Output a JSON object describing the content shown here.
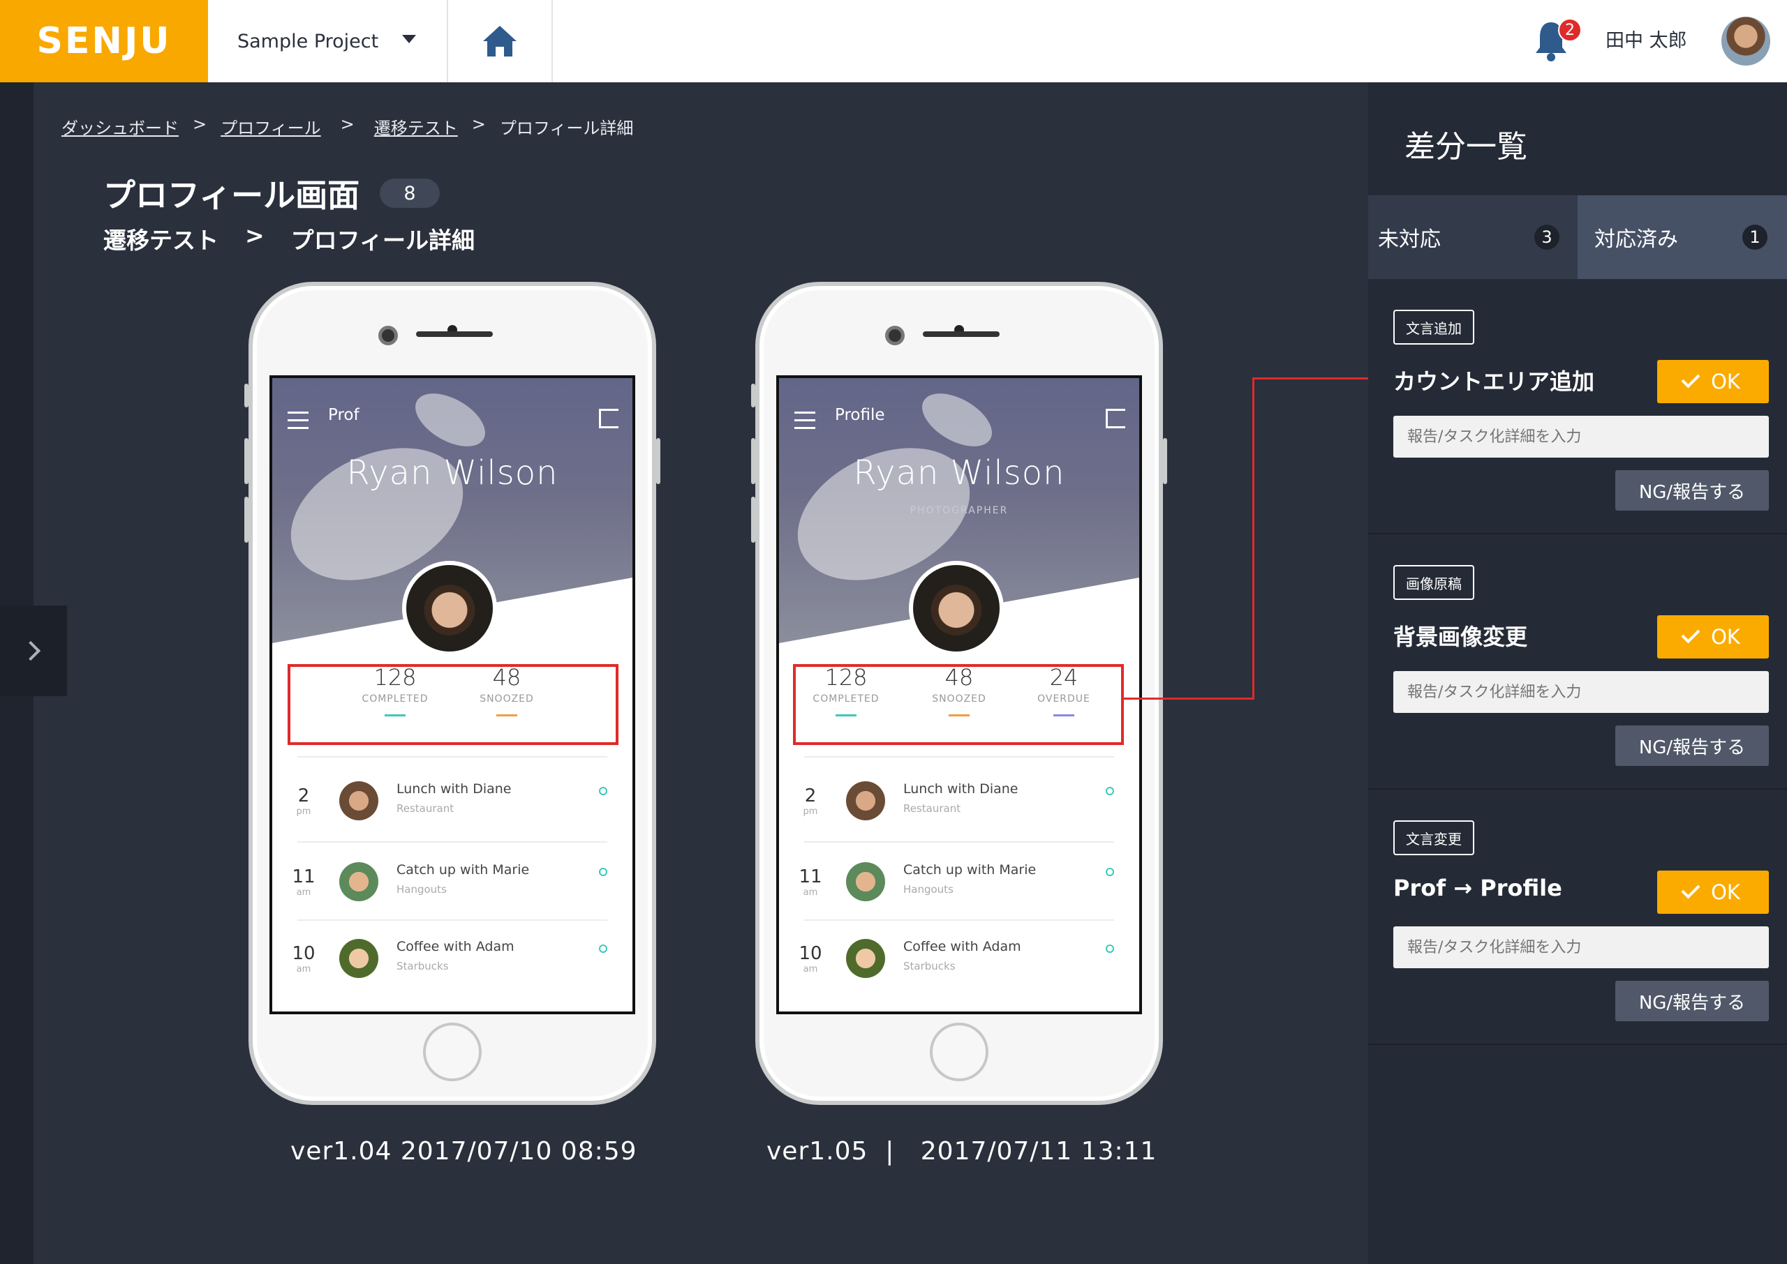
{
  "topbar": {
    "logo": "SENJU",
    "project": "Sample Project",
    "notifications": "2",
    "user_name": "田中 太郎"
  },
  "breadcrumb": [
    "ダッシュボード",
    "プロフィール",
    "遷移テスト",
    "プロフィール詳細"
  ],
  "page": {
    "title": "プロフィール画面",
    "count": "8",
    "sub_from": "遷移テスト",
    "sub_sep": ">",
    "sub_to": "プロフィール詳細"
  },
  "phone_left": {
    "header_title": "Prof",
    "name": "Ryan Wilson",
    "job": "",
    "stats": [
      {
        "value": "128",
        "label": "COMPLETED",
        "color": "#3cc9b9"
      },
      {
        "value": "48",
        "label": "SNOOZED",
        "color": "#f39c47"
      }
    ],
    "version": "ver1.04 2017/07/10 08:59"
  },
  "phone_right": {
    "header_title": "Profile",
    "name": "Ryan Wilson",
    "job": "PHOTOGRAPHER",
    "stats": [
      {
        "value": "128",
        "label": "COMPLETED",
        "color": "#3cc9b9"
      },
      {
        "value": "48",
        "label": "SNOOZED",
        "color": "#f39c47"
      },
      {
        "value": "24",
        "label": "OVERDUE",
        "color": "#8a86e8"
      }
    ],
    "version": "ver1.05  |   2017/07/11 13:11"
  },
  "events": [
    {
      "time": "2",
      "ampm": "pm",
      "title": "Lunch with Diane",
      "place": "Restaurant"
    },
    {
      "time": "11",
      "ampm": "am",
      "title": "Catch up with Marie",
      "place": "Hangouts"
    },
    {
      "time": "10",
      "ampm": "am",
      "title": "Coffee with Adam",
      "place": "Starbucks"
    }
  ],
  "diff_panel": {
    "title": "差分一覧",
    "tab_open": {
      "label": "未対応",
      "count": "3"
    },
    "tab_done": {
      "label": "対応済み",
      "count": "1"
    },
    "items": [
      {
        "tag": "文言追加",
        "label": "カウントエリア追加",
        "ok": "OK",
        "placeholder": "報告/タスク化詳細を入力",
        "ng": "NG/報告する"
      },
      {
        "tag": "画像原稿",
        "label": "背景画像変更",
        "ok": "OK",
        "placeholder": "報告/タスク化詳細を入力",
        "ng": "NG/報告する"
      },
      {
        "tag": "文言変更",
        "label": "Prof → Profile",
        "ok": "OK",
        "placeholder": "報告/タスク化詳細を入力",
        "ng": "NG/報告する"
      }
    ]
  },
  "colors": {
    "brand": "#f9a800",
    "ok": "#fbab00",
    "alert": "#e02a2a",
    "bg": "#2a303c"
  }
}
